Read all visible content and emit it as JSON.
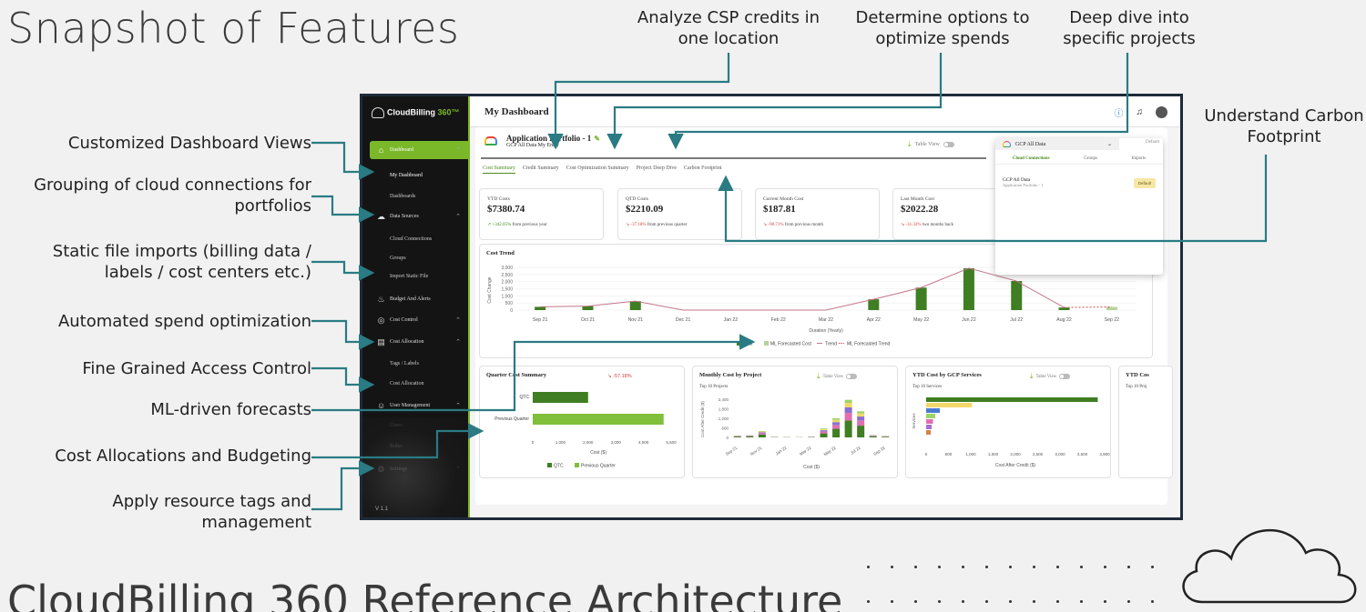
{
  "slide": {
    "title": "Snapshot of Features",
    "bottom_title": "CloudBilling 360 Reference Architecture"
  },
  "callouts": {
    "left": [
      "Customized Dashboard Views",
      "Grouping of cloud connections for portfolios",
      "Static file imports (billing data / labels / cost centers etc.)",
      "Automated spend optimization",
      "Fine Grained Access Control",
      "ML-driven forecasts",
      "Cost Allocations and Budgeting",
      "Apply resource tags and management"
    ],
    "top": [
      "Analyze CSP credits in one location",
      "Determine options to optimize spends",
      "Deep dive into specific projects"
    ],
    "right": "Understand Carbon Footprint"
  },
  "app": {
    "brand": "CloudBilling",
    "brand_num": "360™",
    "version": "V 1.1",
    "sidebar": [
      {
        "label": "Dashboard",
        "icon": "home-icon",
        "active": true
      },
      {
        "label": "My Dashboard",
        "sub": true,
        "current": true
      },
      {
        "label": "Dashboards",
        "sub": true
      },
      {
        "label": "Data Sources",
        "icon": "cloud-icon"
      },
      {
        "label": "Cloud Connections",
        "sub": true
      },
      {
        "label": "Groups",
        "sub": true
      },
      {
        "label": "Import Static File",
        "sub": true
      },
      {
        "label": "Budget And Alerts",
        "icon": "bell-icon"
      },
      {
        "label": "Cost Control",
        "icon": "control-icon"
      },
      {
        "label": "Cost Allocation",
        "icon": "document-icon"
      },
      {
        "label": "Tags / Labels",
        "sub": true
      },
      {
        "label": "Cost Allocation",
        "sub": true
      },
      {
        "label": "User Management",
        "icon": "user-icon"
      },
      {
        "label": "Users",
        "sub": true
      },
      {
        "label": "Roles",
        "sub": true
      },
      {
        "label": "Settings",
        "icon": "settings-icon"
      }
    ],
    "page_title": "My Dashboard",
    "portfolio": {
      "name": "Application Portfolio - 1",
      "sub": "GCP All Data  My Entry",
      "cloud": "Google Cloud"
    },
    "table_view_label": "Table View",
    "tabs": [
      "Cost Summary",
      "Credit Summary",
      "Cost Optimization Summary",
      "Project Deep Dive",
      "Carbon Footprint"
    ],
    "kpis": [
      {
        "label": "YTD Costs",
        "value": "$7380.74",
        "pct": "↗ +342.05%",
        "dir": "up",
        "note": "from previous year"
      },
      {
        "label": "QTD Costs",
        "value": "$2210.09",
        "pct": "↘ -37.18%",
        "dir": "down",
        "note": "from previous quarter"
      },
      {
        "label": "Current Month Cost",
        "value": "$187.81",
        "pct": "↘ -90.71%",
        "dir": "down",
        "note": "from previous month"
      },
      {
        "label": "Last Month Cost",
        "value": "$2022.28",
        "pct": "↘ -31.32%",
        "dir": "down",
        "note": "two months back"
      }
    ],
    "dropdown": {
      "selected": "GCP All Data",
      "default_label": "Default",
      "tabs": [
        "Cloud Connections",
        "Groups",
        "Imports"
      ],
      "item": "GCP All Data",
      "item_sub": "Application Portfolio - 1",
      "badge": "Default"
    },
    "panels": {
      "quarter": {
        "title": "Quarter Cost Summary",
        "pct": "↘ -57.18%"
      },
      "monthly": {
        "title": "Monthly Cost by Project",
        "filter": "Top 10 Projects",
        "table_view": "Table View"
      },
      "ytd": {
        "title": "YTD Cost by GCP Services",
        "filter": "Top 10 Services",
        "table_view": "Table View"
      },
      "ytd2": {
        "title": "YTD Cos",
        "filter": "Top 10 Proj"
      }
    }
  },
  "chart_data": [
    {
      "type": "bar",
      "title": "Cost Trend",
      "xlabel": "Duration (Yearly)",
      "ylabel": "Cost Change",
      "ylim": [
        0,
        3000
      ],
      "yticks": [
        "3,000",
        "2,500",
        "2,000",
        "1,500",
        "1,000",
        "500",
        "0"
      ],
      "categories": [
        "Sep 21",
        "Oct 21",
        "Nov 21",
        "Dec 21",
        "Jan 22",
        "Feb 22",
        "Mar 22",
        "Apr 22",
        "May 22",
        "Jun 22",
        "Jul 22",
        "Aug 22",
        "Sep 22"
      ],
      "series": [
        {
          "name": "Cost",
          "values": [
            230,
            280,
            630,
            0,
            0,
            0,
            0,
            760,
            1580,
            2940,
            2040,
            180,
            null
          ]
        },
        {
          "name": "ML Forecasted Cost",
          "values": [
            null,
            null,
            null,
            null,
            null,
            null,
            null,
            null,
            null,
            null,
            null,
            null,
            220
          ]
        },
        {
          "name": "Trend",
          "values": [
            230,
            280,
            630,
            0,
            0,
            0,
            0,
            760,
            1580,
            2940,
            2040,
            180,
            null
          ]
        },
        {
          "name": "ML Forecasted Trend",
          "values": [
            null,
            null,
            null,
            null,
            null,
            null,
            null,
            null,
            null,
            null,
            null,
            180,
            220
          ]
        }
      ],
      "legend": [
        "Cost",
        "ML Forecasted Cost",
        "Trend",
        "ML Forecasted Trend"
      ],
      "colors": {
        "cost": "#3f7e22",
        "forecast": "#b5d49b",
        "trend": "#c3778a"
      }
    },
    {
      "type": "bar",
      "title": "Quarter Cost Summary",
      "orientation": "horizontal",
      "categories": [
        "QTC",
        "Previous Quarter"
      ],
      "values": [
        2200,
        5200
      ],
      "xlabel": "Cost ($)",
      "xticks": [
        "0",
        "1,000",
        "2,000",
        "3,000",
        "4,000",
        "5,500"
      ],
      "legend": [
        "QTC",
        "Previous Quarter"
      ],
      "colors": [
        "#3f7e22",
        "#7fbf3a"
      ]
    },
    {
      "type": "bar",
      "title": "Monthly Cost by Project",
      "stacked": true,
      "categories": [
        "Sep 21",
        "Oct 21",
        "Nov 21",
        "Dec 21",
        "Jan 22",
        "Feb 22",
        "Mar 22",
        "Apr 22",
        "May 22",
        "Jun 22",
        "Jul 22",
        "Aug 22",
        "Sep 22"
      ],
      "totals": [
        150,
        180,
        500,
        50,
        40,
        30,
        60,
        700,
        1500,
        2950,
        2050,
        200,
        120
      ],
      "ylabel": "Cost After Credit ($)",
      "xlabel": "Cost ($)",
      "yticks": [
        "2,400",
        "1,800",
        "1,200",
        "600",
        "0"
      ]
    },
    {
      "type": "bar",
      "title": "YTD Cost by GCP Services",
      "orientation": "horizontal",
      "values": [
        3750,
        1000,
        300,
        200,
        150,
        120,
        100
      ],
      "colors": [
        "#3f7e22",
        "#f2d86a",
        "#4a7bd0",
        "#9bd36b",
        "#e06fb0",
        "#a66fd0",
        "#d6834a"
      ],
      "ylabel": "Services",
      "xlabel": "Cost After Credit ($)",
      "xticks": [
        "0",
        "500",
        "1,000",
        "1,500",
        "2,000",
        "2,500",
        "3,000",
        "3,500",
        "3,900"
      ]
    }
  ]
}
